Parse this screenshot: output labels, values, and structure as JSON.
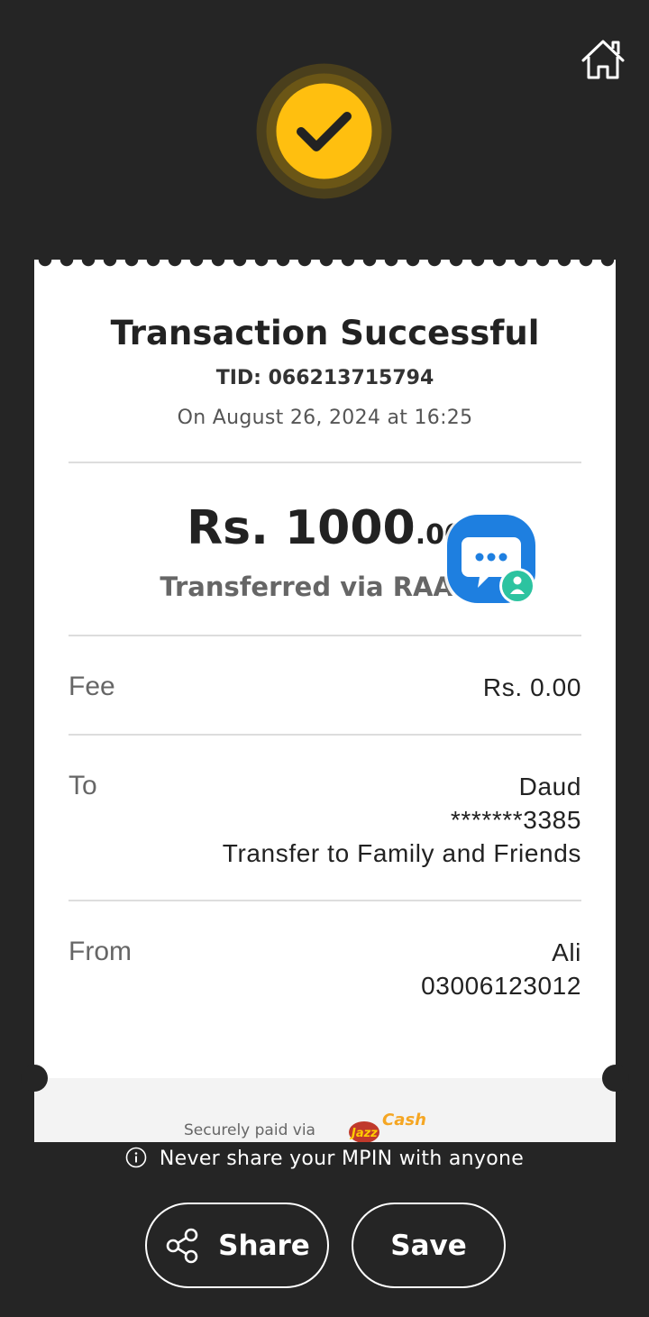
{
  "receipt": {
    "title": "Transaction Successful",
    "tid": "TID: 066213715794",
    "date": "On August 26, 2024 at 16:25",
    "amount": "Rs. 1000",
    "amount_cents": ".00",
    "method": "Transferred via RAAST",
    "fee": {
      "label": "Fee",
      "value": "Rs. 0.00"
    },
    "to": {
      "label": "To",
      "name": "Daud",
      "account": "*******3385",
      "purpose": "Transfer to Family and Friends"
    },
    "from": {
      "label": "From",
      "name": "Ali",
      "account": "03006123012"
    },
    "footer": {
      "secure_text": "Securely paid via",
      "logo_text": "JazzCash"
    }
  },
  "warning": "Never share your MPIN with anyone",
  "actions": {
    "share_label": "Share",
    "save_label": "Save"
  },
  "icons": {
    "home": "home-icon",
    "success": "checkmark-icon",
    "chat": "chat-bubble-icon",
    "info": "info-icon",
    "share": "share-icon"
  },
  "colors": {
    "background": "#252525",
    "accent": "#FFBF0F",
    "card": "#ffffff",
    "chat_blue": "#1E7FE0",
    "chat_badge": "#2CC3A0"
  }
}
